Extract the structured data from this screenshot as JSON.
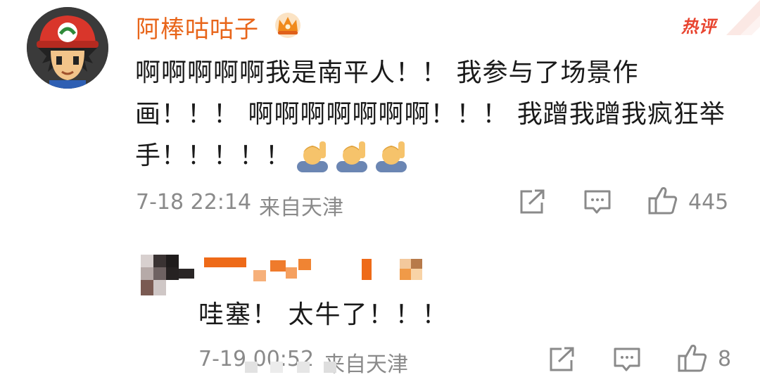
{
  "comment": {
    "username": "阿棒咕咕子",
    "hot_badge": "热评",
    "text": "啊啊啊啊啊我是南平人！！ 我参与了场景作画！！！ 啊啊啊啊啊啊啊！！！ 我蹭我蹭我疯狂举手！！！！！",
    "timestamp": "7-18 22:14",
    "location": "来自天津",
    "like_count": "445",
    "icons": [
      "avatar",
      "crown-icon",
      "raising-hand-emoji",
      "repost-icon",
      "comment-icon",
      "like-icon"
    ],
    "colors": {
      "username": "#e8651a",
      "hot_badge": "#e8442f",
      "meta": "#8a8a8a"
    }
  },
  "reply": {
    "text": "哇塞！ 太牛了！！！",
    "timestamp": "7-19 00:52",
    "location": "来自天津",
    "like_count": "8"
  }
}
